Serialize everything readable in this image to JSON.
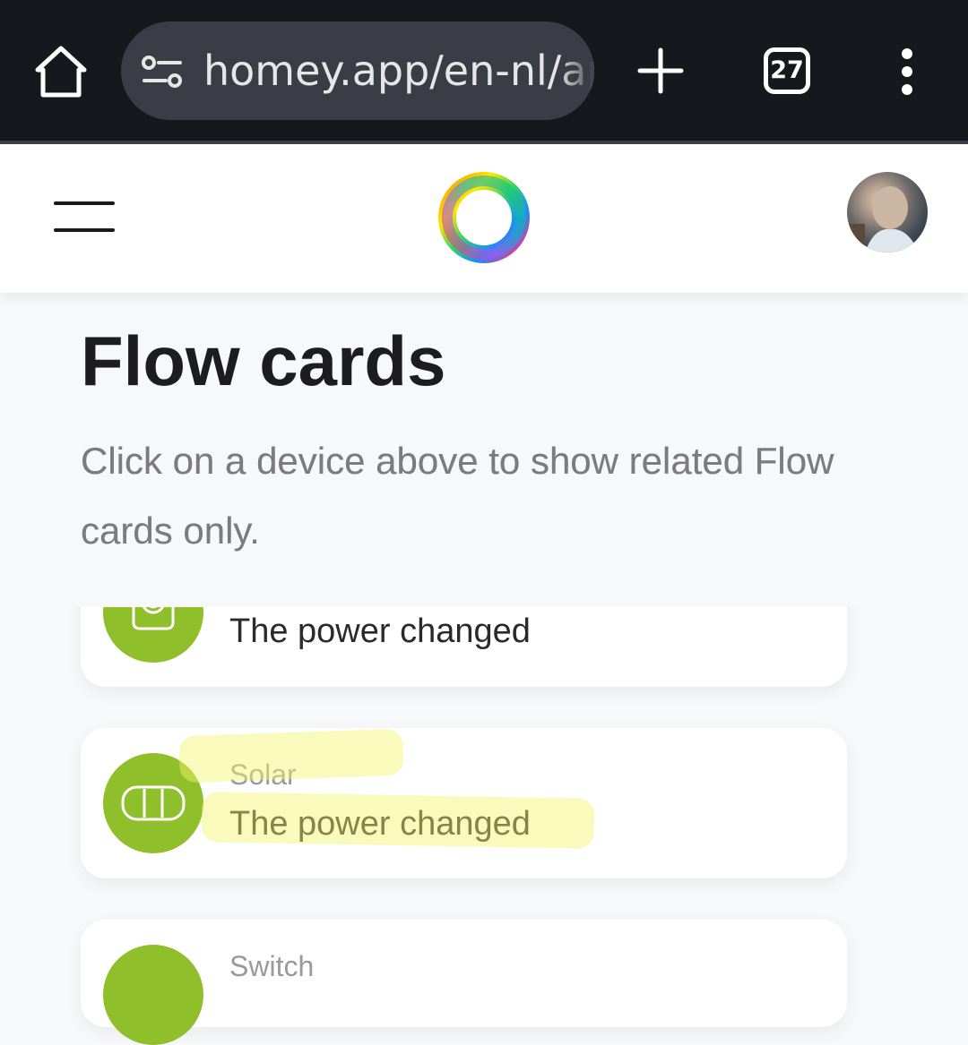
{
  "browser": {
    "url": "homey.app/en-nl/app",
    "tab_count": "27",
    "icons": [
      "home-icon",
      "tune-icon",
      "plus-icon",
      "tab-switcher-icon",
      "more-vert-icon"
    ]
  },
  "header": {
    "icons": [
      "menu-icon",
      "homey-logo",
      "avatar"
    ]
  },
  "page": {
    "title": "Flow cards",
    "subtitle": "Click on a device above to show related Flow cards only."
  },
  "cards": [
    {
      "label": "",
      "title": "The power changed",
      "icon": "meter-icon"
    },
    {
      "label": "Solar",
      "title": "The power changed",
      "icon": "solar-panel-icon"
    },
    {
      "label": "Switch",
      "title": "",
      "icon": "switch-icon"
    }
  ],
  "colors": {
    "browser_bg": "#16181d",
    "url_pill": "#3a3d46",
    "card_icon": "#8fbf2a",
    "highlight": "#f4f46a"
  }
}
